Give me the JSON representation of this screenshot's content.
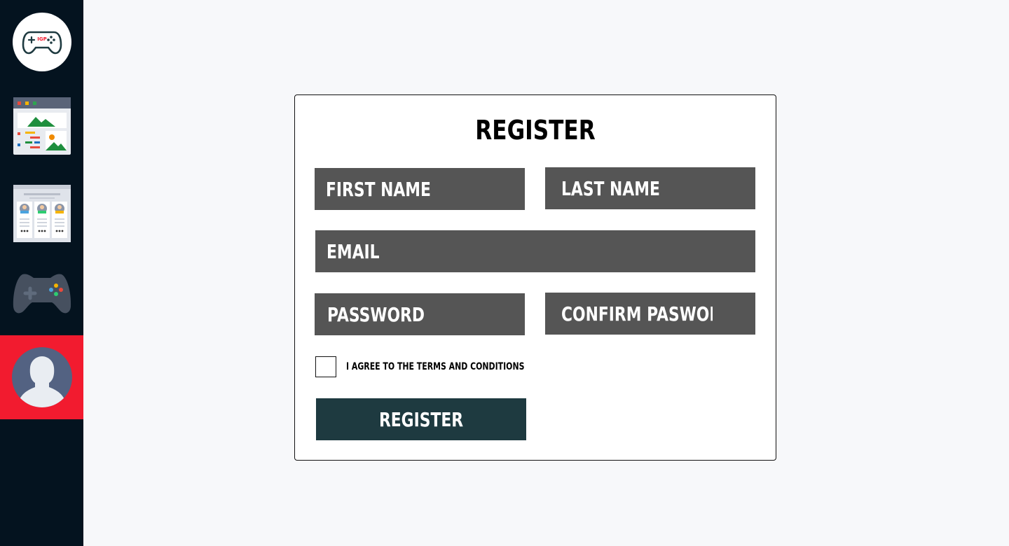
{
  "sidebar": {
    "items": [
      {
        "name": "logo",
        "icon": "gamepad-logo-icon",
        "badge": "IGP"
      },
      {
        "name": "dashboard",
        "icon": "browser-gallery-icon"
      },
      {
        "name": "profiles",
        "icon": "profile-cards-icon"
      },
      {
        "name": "games",
        "icon": "game-controller-icon"
      },
      {
        "name": "account",
        "icon": "user-avatar-icon",
        "active": true
      }
    ],
    "active_color": "#f21b2f",
    "background": "#04131f"
  },
  "form": {
    "title": "Register",
    "fields": {
      "first_name": {
        "placeholder": "First Name",
        "value": ""
      },
      "last_name": {
        "placeholder": "Last Name",
        "value": ""
      },
      "email": {
        "placeholder": "Email",
        "value": ""
      },
      "password": {
        "placeholder": "Password",
        "value": ""
      },
      "confirm_password": {
        "placeholder": "Confirm Pasword",
        "value": ""
      }
    },
    "terms_label": "I agree to the terms and conditions",
    "terms_checked": false,
    "submit_label": "Register",
    "field_color": "#555555",
    "button_color": "#1e3a40"
  }
}
